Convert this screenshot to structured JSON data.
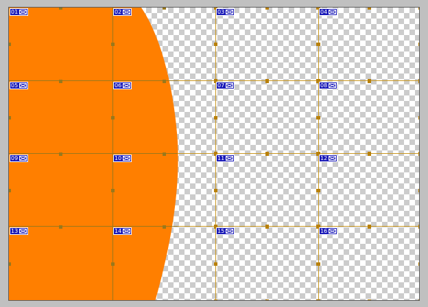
{
  "colors": {
    "workspace": "#c0c0c0",
    "fill": "#ff7f00",
    "slice_line_on_fill": "#99781c",
    "slice_line_on_transparent": "#c8961e",
    "handle": "#b8800a",
    "badge_background": "#1a1ab8",
    "badge_text": "#ffffff"
  },
  "badge_icon": "image-slice-icon",
  "slices": [
    {
      "number": "01",
      "selected": false
    },
    {
      "number": "02",
      "selected": false
    },
    {
      "number": "03",
      "selected": true
    },
    {
      "number": "04",
      "selected": true
    },
    {
      "number": "05",
      "selected": false
    },
    {
      "number": "06",
      "selected": false
    },
    {
      "number": "07",
      "selected": true
    },
    {
      "number": "08",
      "selected": true
    },
    {
      "number": "09",
      "selected": false
    },
    {
      "number": "10",
      "selected": false
    },
    {
      "number": "11",
      "selected": true
    },
    {
      "number": "12",
      "selected": true
    },
    {
      "number": "13",
      "selected": false
    },
    {
      "number": "14",
      "selected": false
    },
    {
      "number": "15",
      "selected": true
    },
    {
      "number": "16",
      "selected": true
    }
  ]
}
